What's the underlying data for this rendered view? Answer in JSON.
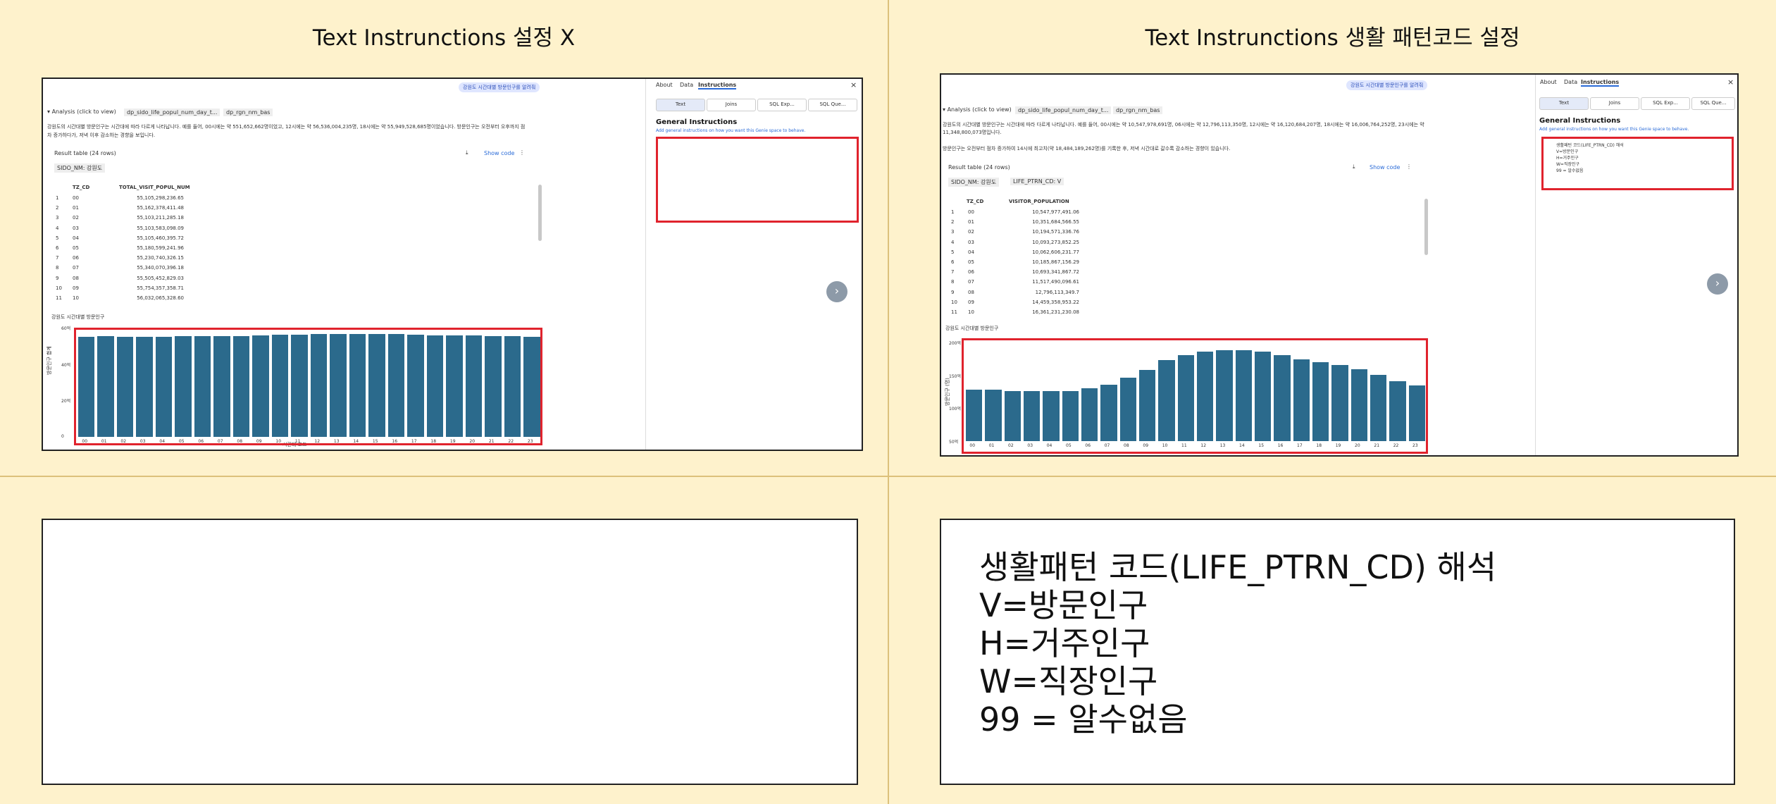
{
  "left": {
    "title": "Text Instrunctions 설정 X",
    "genie_chip": "강원도 시간대별 방문인구를 알려줘",
    "analysis_label": "Analysis (click to view)",
    "tag1": "dp_sido_life_popul_num_day_t...",
    "tag2": "dp_rgn_nm_bas",
    "summary_line1": "강원도의 시간대별 방문인구는 시간대에 따라 다르게 나타납니다. 예를 들어, 00시에는 약 551,652,662명이었고, 12시에는 약 56,536,004,235명, 18시에는 약 55,949,528,685명이었습니다. 방문인구는 오전부터 오후까지 점",
    "summary_line2": "차 증가하다가, 저녁 이후 감소하는 경향을 보입니다.",
    "result_table": "Result table (24 rows)",
    "show_code": "Show code",
    "filter_chip": "SIDO_NM: 강원도",
    "col1": "TZ_CD",
    "col2": "TOTAL_VISIT_POPUL_NUM",
    "rows": [
      [
        "1",
        "00",
        "55,105,298,236.65"
      ],
      [
        "2",
        "01",
        "55,162,378,411.48"
      ],
      [
        "3",
        "02",
        "55,103,211,285.18"
      ],
      [
        "4",
        "03",
        "55,103,583,098.09"
      ],
      [
        "5",
        "04",
        "55,105,460,395.72"
      ],
      [
        "6",
        "05",
        "55,180,599,241.96"
      ],
      [
        "7",
        "06",
        "55,230,740,326.15"
      ],
      [
        "8",
        "07",
        "55,340,070,396.18"
      ],
      [
        "9",
        "08",
        "55,505,452,829.03"
      ],
      [
        "10",
        "09",
        "55,754,357,358.71"
      ],
      [
        "11",
        "10",
        "56,032,065,328.60"
      ]
    ],
    "chart_title": "강원도 시간대별 방문인구",
    "y_label": "방문인구 합계",
    "x_label": "시간대 코드",
    "y_ticks": [
      "60억",
      "40억",
      "20억",
      "0"
    ],
    "panel_tabs": [
      "About",
      "Data",
      "Instructions"
    ],
    "panel_buttons": [
      "Text",
      "Joins",
      "SQL Exp...",
      "SQL Que..."
    ],
    "general_title": "General Instructions",
    "general_sub": "Add general instructions on how you want this Genie space to behave.",
    "instructions": []
  },
  "right": {
    "title": "Text Instrunctions 생활 패턴코드 설정",
    "genie_chip": "강원도 시간대별 방문인구를 알려줘",
    "analysis_label": "Analysis (click to view)",
    "tag1": "dp_sido_life_popul_num_day_t...",
    "tag2": "dp_rgn_nm_bas",
    "summary_line1": "강원도의 시간대별 방문인구는 시간대에 따라 다르게 나타납니다. 예를 들어, 00시에는 약 10,547,978,691명, 06시에는 약 12,796,113,350명, 12시에는 약 16,120,684,207명, 18시에는 약 16,006,764,252명, 23시에는 약",
    "summary_line2": "11,348,800,073명입니다.",
    "summary_line3": "방문인구는 오전부터 점차 증가하여 14시에 최고치(약 18,484,189,262명)를 기록한 후, 저녁 시간대로 갈수록 감소하는 경향이 있습니다.",
    "result_table": "Result table (24 rows)",
    "show_code": "Show code",
    "filter_chip": "SIDO_NM: 강원도",
    "filter_chip2": "LIFE_PTRN_CD: V",
    "col1": "TZ_CD",
    "col2": "VISITOR_POPULATION",
    "rows": [
      [
        "1",
        "00",
        "10,547,977,491.06"
      ],
      [
        "2",
        "01",
        "10,351,684,566.55"
      ],
      [
        "3",
        "02",
        "10,194,571,336.76"
      ],
      [
        "4",
        "03",
        "10,093,273,852.25"
      ],
      [
        "5",
        "04",
        "10,062,606,231.77"
      ],
      [
        "6",
        "05",
        "10,185,867,156.29"
      ],
      [
        "7",
        "06",
        "10,693,341,867.72"
      ],
      [
        "8",
        "07",
        "11,517,490,096.61"
      ],
      [
        "9",
        "08",
        "12,796,113,349.7"
      ],
      [
        "10",
        "09",
        "14,459,358,953.22"
      ],
      [
        "11",
        "10",
        "16,361,231,230.08"
      ]
    ],
    "chart_title": "강원도 시간대별 방문인구",
    "y_label": "방문인구 (명)",
    "y_ticks": [
      "200억",
      "150억",
      "100억",
      "50억"
    ],
    "panel_tabs": [
      "About",
      "Data",
      "Instructions"
    ],
    "panel_buttons": [
      "Text",
      "Joins",
      "SQL Exp...",
      "SQL Que..."
    ],
    "general_title": "General Instructions",
    "general_sub": "Add general instructions on how you want this Genie space to behave.",
    "instructions": [
      "생활패턴 코드(LIFE_PTRN_CD) 해석",
      "V=방문인구",
      "H=거주인구",
      "W=직장인구",
      "99 = 알수없음"
    ]
  },
  "bottom_right_lines": [
    "생활패턴 코드(LIFE_PTRN_CD) 해석",
    "V=방문인구",
    "H=거주인구",
    "W=직장인구",
    "99 = 알수없음"
  ],
  "chart_data": [
    {
      "type": "bar",
      "categories": [
        "00",
        "01",
        "02",
        "03",
        "04",
        "05",
        "06",
        "07",
        "08",
        "09",
        "10",
        "11",
        "12",
        "13",
        "14",
        "15",
        "16",
        "17",
        "18",
        "19",
        "20",
        "21",
        "22",
        "23"
      ],
      "values": [
        55.1,
        55.2,
        55.1,
        55.1,
        55.1,
        55.2,
        55.2,
        55.3,
        55.5,
        55.8,
        56.0,
        56.3,
        56.5,
        56.6,
        56.7,
        56.6,
        56.4,
        56.2,
        55.9,
        55.7,
        55.6,
        55.4,
        55.2,
        55.1
      ],
      "title": "강원도 시간대별 방문인구",
      "ylabel": "방문인구 합계",
      "xlabel": "시간대 코드",
      "ylim": [
        0,
        60
      ]
    },
    {
      "type": "bar",
      "categories": [
        "00",
        "01",
        "02",
        "03",
        "04",
        "05",
        "06",
        "07",
        "08",
        "09",
        "10",
        "11",
        "12",
        "13",
        "14",
        "15",
        "16",
        "17",
        "18",
        "19",
        "20",
        "21",
        "22",
        "23"
      ],
      "values": [
        10.5,
        10.4,
        10.2,
        10.1,
        10.1,
        10.2,
        10.7,
        11.5,
        12.8,
        14.5,
        16.4,
        17.5,
        18.1,
        18.4,
        18.5,
        18.2,
        17.4,
        16.6,
        16.0,
        15.4,
        14.6,
        13.4,
        12.2,
        11.3
      ],
      "title": "강원도 시간대별 방문인구",
      "ylabel": "방문인구 (명)",
      "ylim": [
        0,
        20
      ]
    }
  ],
  "colors": {
    "background": "#fef2cc",
    "bar": "#2b6a8c",
    "highlight": "#e0232d"
  }
}
